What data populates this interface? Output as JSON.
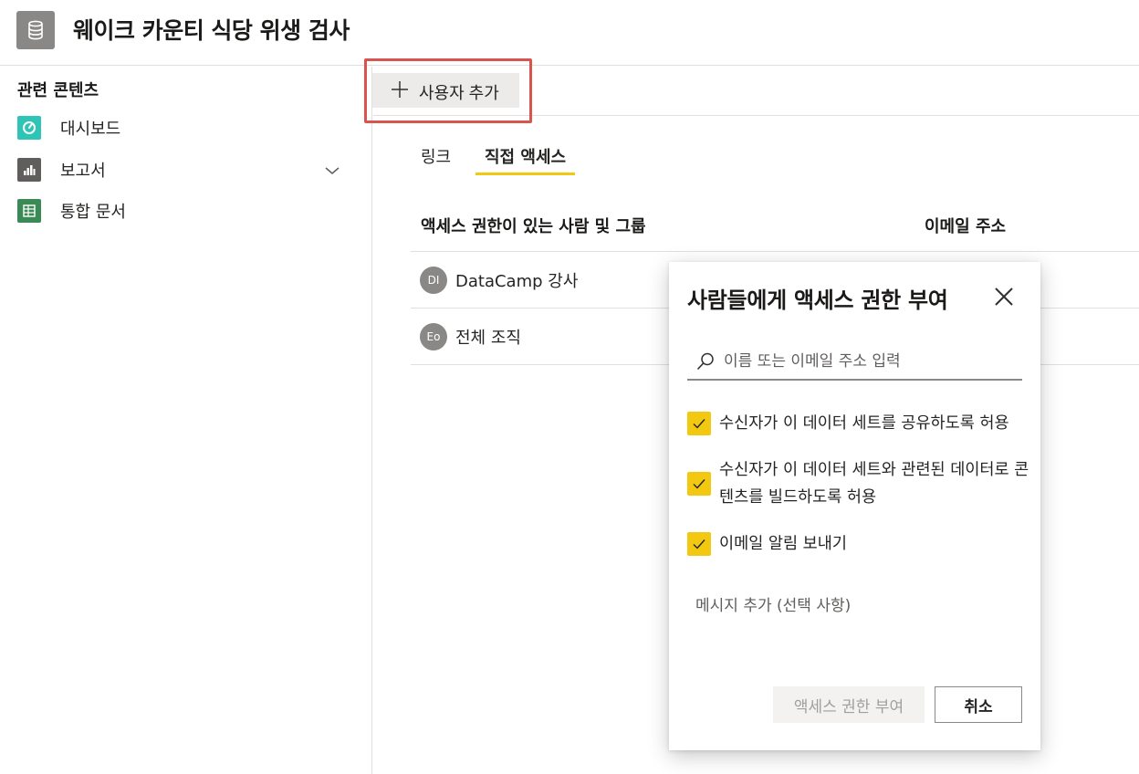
{
  "header": {
    "title": "웨이크 카운티 식당 위생 검사",
    "icon": "database-icon"
  },
  "sidebar": {
    "section_title": "관련 콘텐츠",
    "items": [
      {
        "label": "대시보드",
        "icon": "dashboard-icon",
        "color": "#2ec4b6"
      },
      {
        "label": "보고서",
        "icon": "report-icon",
        "color": "#605e5c",
        "expandable": true
      },
      {
        "label": "통합 문서",
        "icon": "workbook-icon",
        "color": "#3a8a55"
      }
    ]
  },
  "toolbar": {
    "add_user_label": "사용자 추가"
  },
  "tabs": [
    {
      "label": "링크",
      "active": false
    },
    {
      "label": "직접 액세스",
      "active": true
    }
  ],
  "access_table": {
    "columns": [
      "액세스 권한이 있는 사람 및 그룹",
      "이메일 주소"
    ],
    "rows": [
      {
        "initials": "DI",
        "name": "DataCamp 강사"
      },
      {
        "initials": "Eo",
        "name": "전체 조직"
      }
    ]
  },
  "dialog": {
    "title": "사람들에게 액세스 권한 부여",
    "search_placeholder": "이름 또는 이메일 주소 입력",
    "search_value": "",
    "options": [
      {
        "label": "수신자가 이 데이터 세트를 공유하도록 허용",
        "checked": true
      },
      {
        "label": "수신자가 이 데이터 세트와 관련된 데이터로 콘텐츠를 빌드하도록 허용",
        "checked": true
      },
      {
        "label": "이메일 알림 보내기",
        "checked": true
      }
    ],
    "message_link": "메시지 추가 (선택 사항)",
    "grant_button": "액세스 권한 부여",
    "cancel_button": "취소"
  },
  "colors": {
    "accent": "#f2c811",
    "highlight": "#d9534f",
    "avatar": "#8a8886"
  }
}
